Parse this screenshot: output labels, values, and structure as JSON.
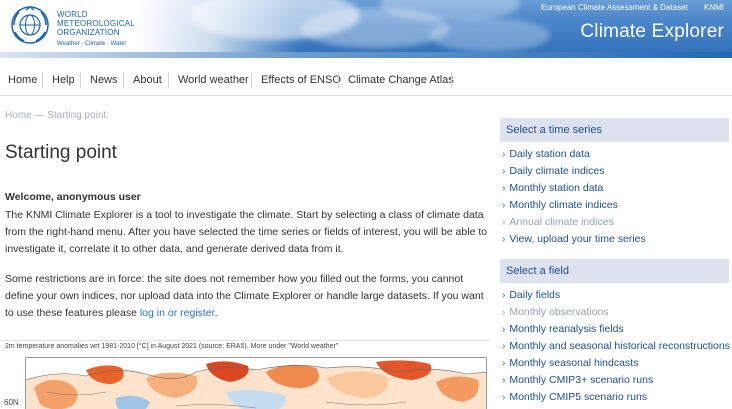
{
  "header": {
    "org_name_lines": [
      "WORLD",
      "METEOROLOGICAL",
      "ORGANIZATION"
    ],
    "org_tagline": "Weather · Climate · Water",
    "top_links": [
      "European Climate Assessment & Dataset",
      "KNMI"
    ],
    "site_title": "Climate Explorer"
  },
  "nav": {
    "items": [
      "Home",
      "Help",
      "News",
      "About",
      "World weather",
      "Effects of ENSO",
      "Climate Change Atlas"
    ]
  },
  "main": {
    "breadcrumb": "Home — Starting point:",
    "title": "Starting point",
    "welcome": "Welcome, anonymous user",
    "paragraph1": "The KNMI Climate Explorer is a tool to investigate the climate. Start by selecting a class of climate data from the right-hand menu. After you have selected the time series or fields of interest, you will be able to investigate it, correlate it to other data, and generate derived data from it.",
    "paragraph2_before": "Some restrictions are in force: the site does not remember how you filled out the forms, you cannot define your own indices, nor upload data into the Climate Explorer or handle large datasets. If you want to use these features please ",
    "paragraph2_link": "log in or register",
    "paragraph2_after": ".",
    "map_caption": "2m temperature anomalies wrt 1981-2010 [°C] in August 2021 (source: ERA5). More under \"World weather\"",
    "lat_label": "60N"
  },
  "sidebar": {
    "time_series_heading": "Select a time series",
    "time_series_items": [
      {
        "label": "Daily station data",
        "enabled": true
      },
      {
        "label": "Daily climate indices",
        "enabled": true
      },
      {
        "label": "Monthly station data",
        "enabled": true
      },
      {
        "label": "Monthly climate indices",
        "enabled": true
      },
      {
        "label": "Annual climate indices",
        "enabled": false
      },
      {
        "label": "View, upload your time series",
        "enabled": true
      }
    ],
    "field_heading": "Select a field",
    "field_items": [
      {
        "label": "Daily fields",
        "enabled": true
      },
      {
        "label": "Monthly observations",
        "enabled": false
      },
      {
        "label": "Monthly reanalysis fields",
        "enabled": true
      },
      {
        "label": "Monthly and seasonal historical reconstructions",
        "enabled": true
      },
      {
        "label": "Monthly seasonal hindcasts",
        "enabled": true
      },
      {
        "label": "Monthly CMIP3+ scenario runs",
        "enabled": true
      },
      {
        "label": "Monthly CMIP5 scenario runs",
        "enabled": true
      }
    ]
  },
  "colors": {
    "accent": "#2a72c0",
    "sidebar_heading_bg": "#dde2ee",
    "link_muted": "#93a2bd"
  }
}
